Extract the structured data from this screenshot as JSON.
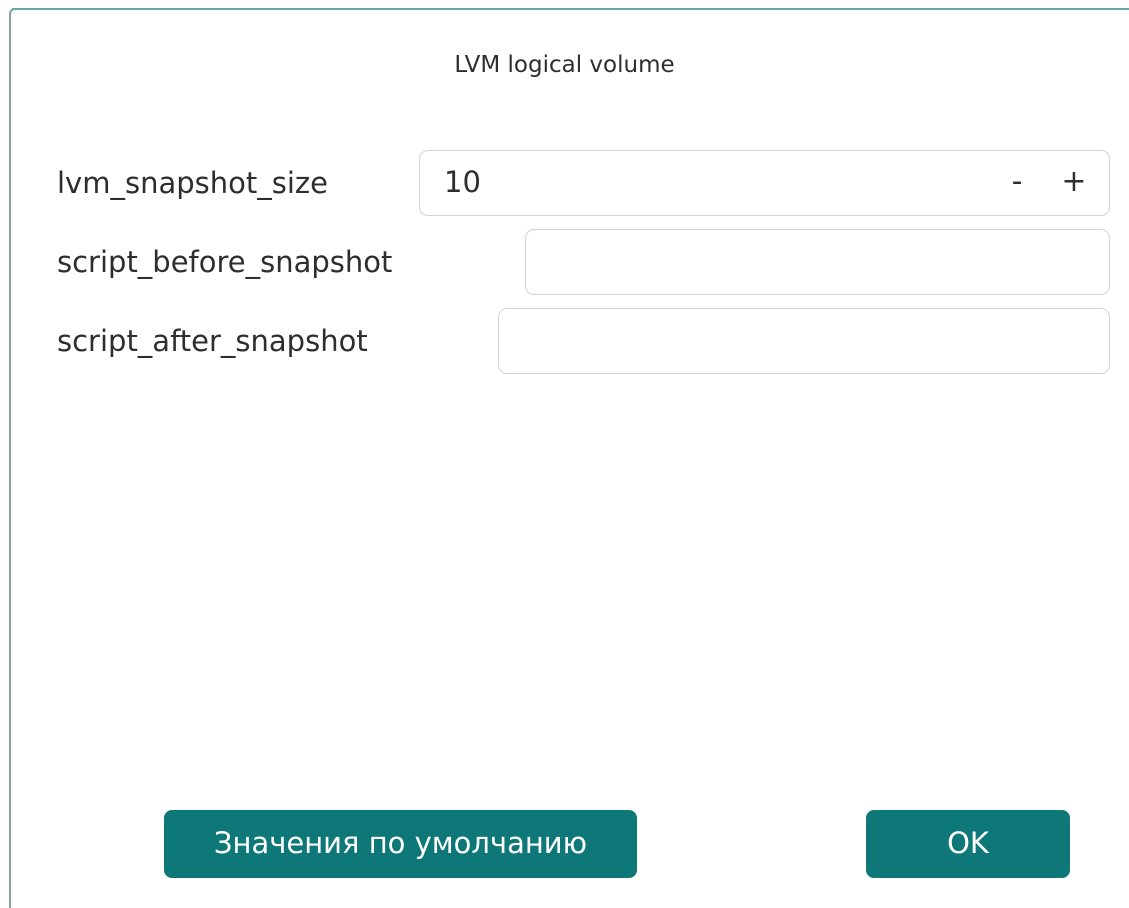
{
  "dialog": {
    "title": "LVM logical volume"
  },
  "fields": {
    "lvm_snapshot_size": {
      "label": "lvm_snapshot_size",
      "value": "10",
      "decrement_label": "-",
      "increment_label": "+"
    },
    "script_before_snapshot": {
      "label": "script_before_snapshot",
      "value": "",
      "placeholder": ""
    },
    "script_after_snapshot": {
      "label": "script_after_snapshot",
      "value": "",
      "placeholder": ""
    }
  },
  "buttons": {
    "defaults_label": "Значения по умолчанию",
    "ok_label": "OK"
  },
  "colors": {
    "accent": "#0e7777",
    "button_text": "#ffffff",
    "field_border": "#d4d4d4",
    "text": "#2e2e2e"
  }
}
